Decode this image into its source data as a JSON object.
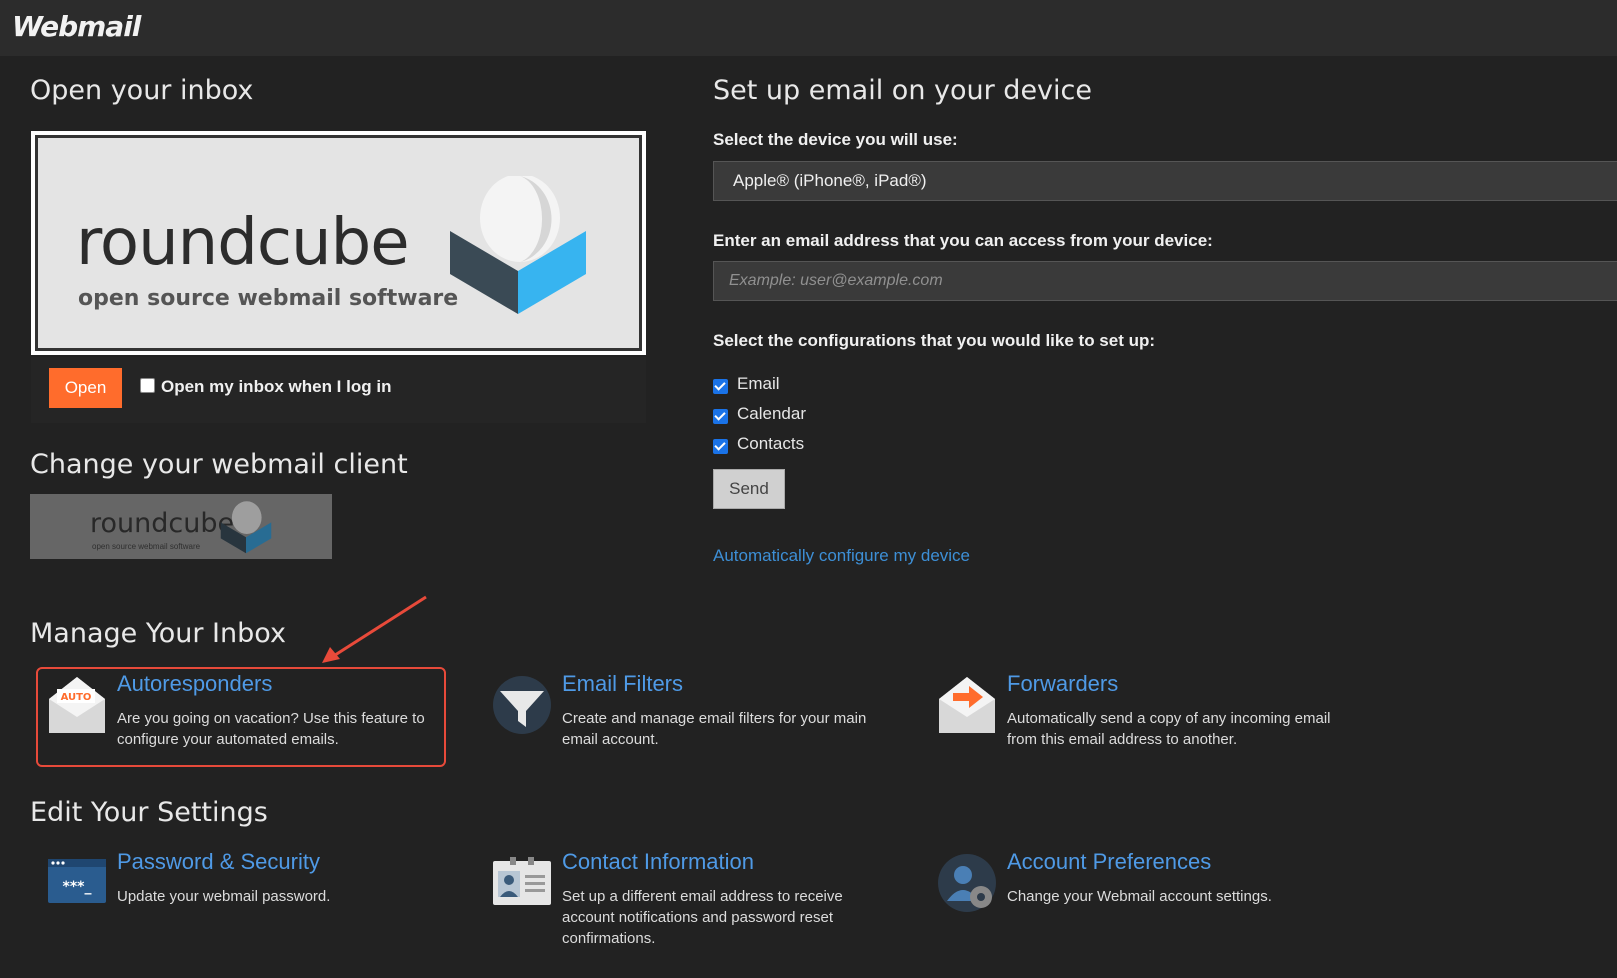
{
  "header": {
    "brand": "Webmail"
  },
  "inbox": {
    "heading": "Open your inbox",
    "logo_word": "roundcube",
    "logo_sub": "open source webmail software",
    "open_button": "Open",
    "auto_open_label": "Open my inbox when I log in",
    "auto_open_checked": false
  },
  "client": {
    "heading": "Change your webmail client",
    "thumb_word": "roundcube",
    "thumb_sub": "open source webmail software"
  },
  "device": {
    "heading": "Set up email on your device",
    "device_label": "Select the device you will use:",
    "device_selected": "Apple® (iPhone®, iPad®)",
    "email_label": "Enter an email address that you can access from your device:",
    "email_placeholder": "Example: user@example.com",
    "config_label": "Select the configurations that you would like to set up:",
    "configs": [
      {
        "label": "Email",
        "checked": true
      },
      {
        "label": "Calendar",
        "checked": true
      },
      {
        "label": "Contacts",
        "checked": true
      }
    ],
    "send_button": "Send",
    "auto_link": "Automatically configure my device"
  },
  "manage": {
    "heading": "Manage Your Inbox",
    "items": [
      {
        "title": "Autoresponders",
        "desc": "Are you going on vacation? Use this feature to configure your automated emails.",
        "icon": "autoresponder-envelope-icon",
        "badge": "AUTO"
      },
      {
        "title": "Email Filters",
        "desc": "Create and manage email filters for your main email account.",
        "icon": "funnel-filter-icon"
      },
      {
        "title": "Forwarders",
        "desc": "Automatically send a copy of any incoming email from this email address to another.",
        "icon": "forward-envelope-icon"
      }
    ]
  },
  "settings": {
    "heading": "Edit Your Settings",
    "items": [
      {
        "title": "Password & Security",
        "desc": "Update your webmail password.",
        "icon": "password-window-icon",
        "mask": "***_"
      },
      {
        "title": "Contact Information",
        "desc": "Set up a different email address to receive account notifications and password reset confirmations.",
        "icon": "contact-card-icon"
      },
      {
        "title": "Account Preferences",
        "desc": "Change your Webmail account settings.",
        "icon": "user-gear-icon"
      }
    ]
  },
  "colors": {
    "accent": "#ff6c2c",
    "link": "#4f9ae6",
    "highlight": "#e84a3a",
    "bg": "#222222"
  }
}
